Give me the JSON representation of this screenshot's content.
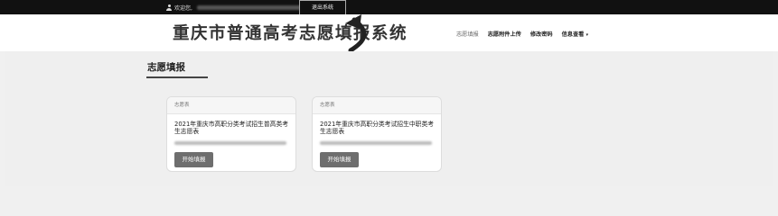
{
  "topbar": {
    "welcome": "欢迎您,",
    "logout_label": "退出系统"
  },
  "header": {
    "site_title": "重庆市普通高考志愿填报系统"
  },
  "nav": {
    "items": [
      {
        "label": "志愿填报"
      },
      {
        "label": "志愿附件上传"
      },
      {
        "label": "修改密码"
      },
      {
        "label": "信息查看"
      }
    ],
    "caret": "▾"
  },
  "main": {
    "page_title": "志愿填报",
    "cards": [
      {
        "header": "志愿表",
        "title": "2021年重庆市高职分类考试招生普高类考生志愿表",
        "button_label": "开始填报"
      },
      {
        "header": "志愿表",
        "title": "2021年重庆市高职分类考试招生中职类考生志愿表",
        "button_label": "开始填报"
      }
    ]
  },
  "colors": {
    "topbar_bg": "#111111",
    "button_bg": "#6e6e6e"
  }
}
